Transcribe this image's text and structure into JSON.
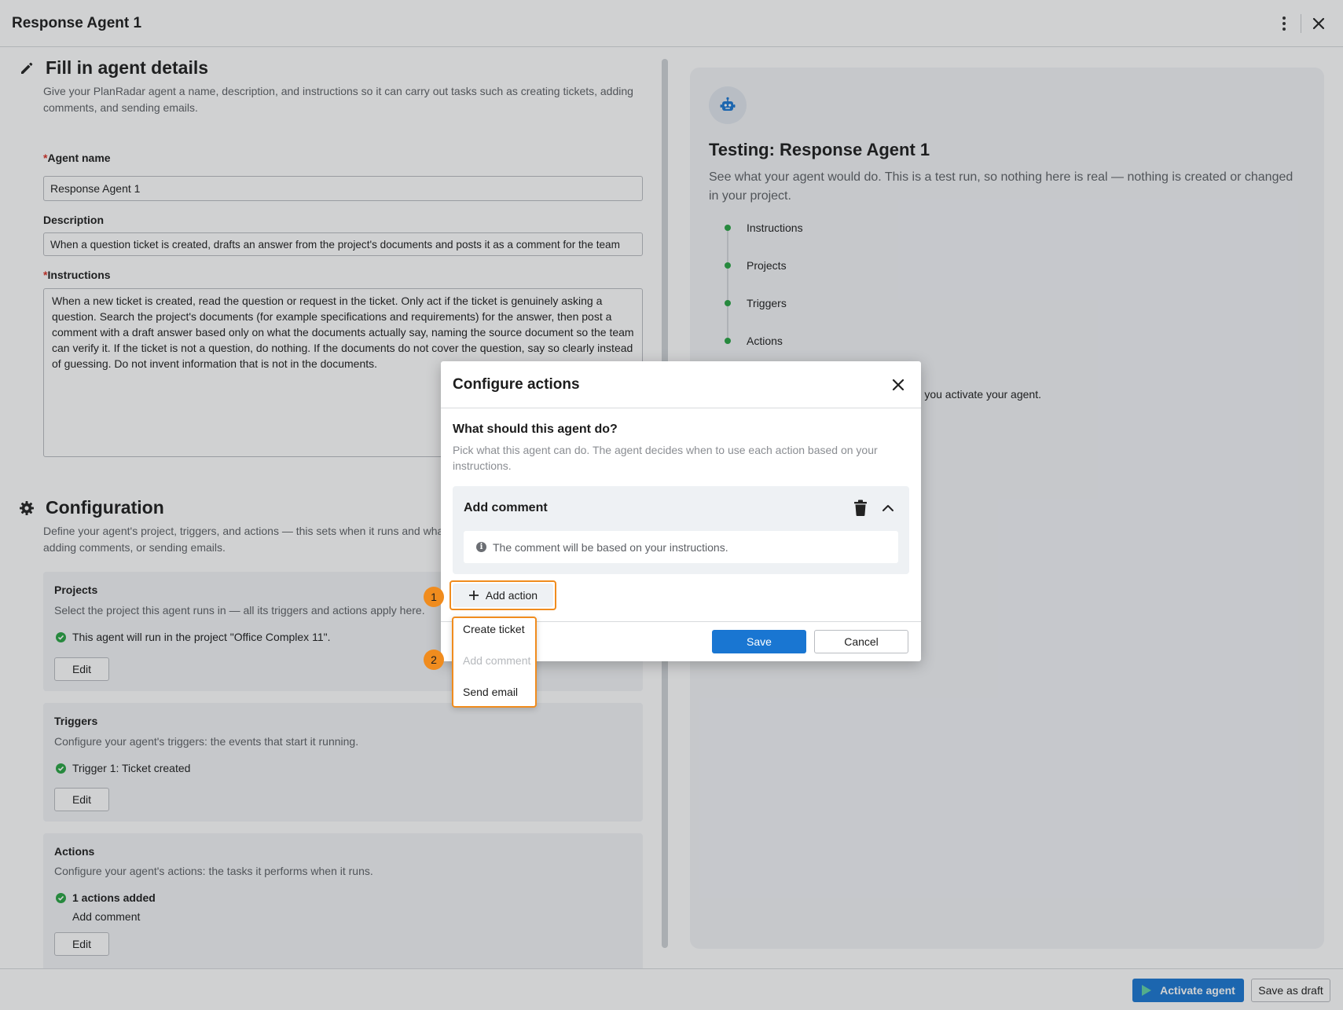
{
  "window": {
    "title": "Response Agent 1"
  },
  "details": {
    "heading": "Fill in agent details",
    "description": "Give your PlanRadar agent a name, description, and instructions so it can carry out tasks such as creating tickets, adding comments, and sending emails.",
    "agent_name_label": "Agent name",
    "agent_name_value": "Response Agent 1",
    "description_label": "Description",
    "description_value": "When a question ticket is created, drafts an answer from the project's documents and posts it as a comment for the team",
    "instructions_label": "Instructions",
    "instructions_value": "When a new ticket is created, read the question or request in the ticket. Only act if the ticket is genuinely asking a question. Search the project's documents (for example specifications and requirements) for the answer, then post a comment with a draft answer based only on what the documents actually say, naming the source document so the team can verify it. If the ticket is not a question, do nothing. If the documents do not cover the question, say so clearly instead of guessing. Do not invent information that is not in the documents.",
    "required_mark": "*"
  },
  "configuration": {
    "heading": "Configuration",
    "description": "Define your agent's project, triggers, and actions — this sets when it runs and what it does, such as creating tickets, adding comments, or sending emails.",
    "projects": {
      "title": "Projects",
      "description": "Select the project this agent runs in — all its triggers and actions apply here.",
      "status": "This agent will run in the project \"Office Complex 11\".",
      "edit": "Edit"
    },
    "triggers": {
      "title": "Triggers",
      "description": "Configure your agent's triggers: the events that start it running.",
      "status": "Trigger 1: Ticket created",
      "edit": "Edit"
    },
    "actions": {
      "title": "Actions",
      "description": "Configure your agent's actions: the tasks it performs when it runs.",
      "status": "1 actions added",
      "item": "Add comment",
      "edit": "Edit"
    }
  },
  "testing": {
    "title": "Testing: Response Agent 1",
    "description": "See what your agent would do. This is a test run, so nothing here is real — nothing is created or changed in your project.",
    "steps": [
      "Instructions",
      "Projects",
      "Triggers",
      "Actions"
    ],
    "partial_text": "re you activate your agent."
  },
  "footer": {
    "activate": "Activate agent",
    "save_draft": "Save as draft"
  },
  "modal": {
    "title": "Configure actions",
    "question": "What should this agent do?",
    "question_desc": "Pick what this agent can do. The agent decides when to use each action based on your instructions.",
    "action_card_title": "Add comment",
    "action_card_info": "The comment will be based on your instructions.",
    "add_action": "Add action",
    "save": "Save",
    "cancel": "Cancel"
  },
  "dropdown": {
    "items": [
      {
        "label": "Create ticket",
        "enabled": true
      },
      {
        "label": "Add comment",
        "enabled": false
      },
      {
        "label": "Send email",
        "enabled": true
      }
    ]
  },
  "annotations": {
    "badge1": "1",
    "badge2": "2"
  },
  "colors": {
    "accent": "#1976d2",
    "success": "#27a342",
    "highlight": "#f08c1e"
  },
  "icons": [
    "pencil-icon",
    "gear-icon",
    "robot-icon",
    "kebab-menu-icon",
    "close-icon",
    "trash-icon",
    "chevron-up-icon",
    "plus-icon",
    "info-icon",
    "check-circle-icon",
    "play-icon"
  ]
}
